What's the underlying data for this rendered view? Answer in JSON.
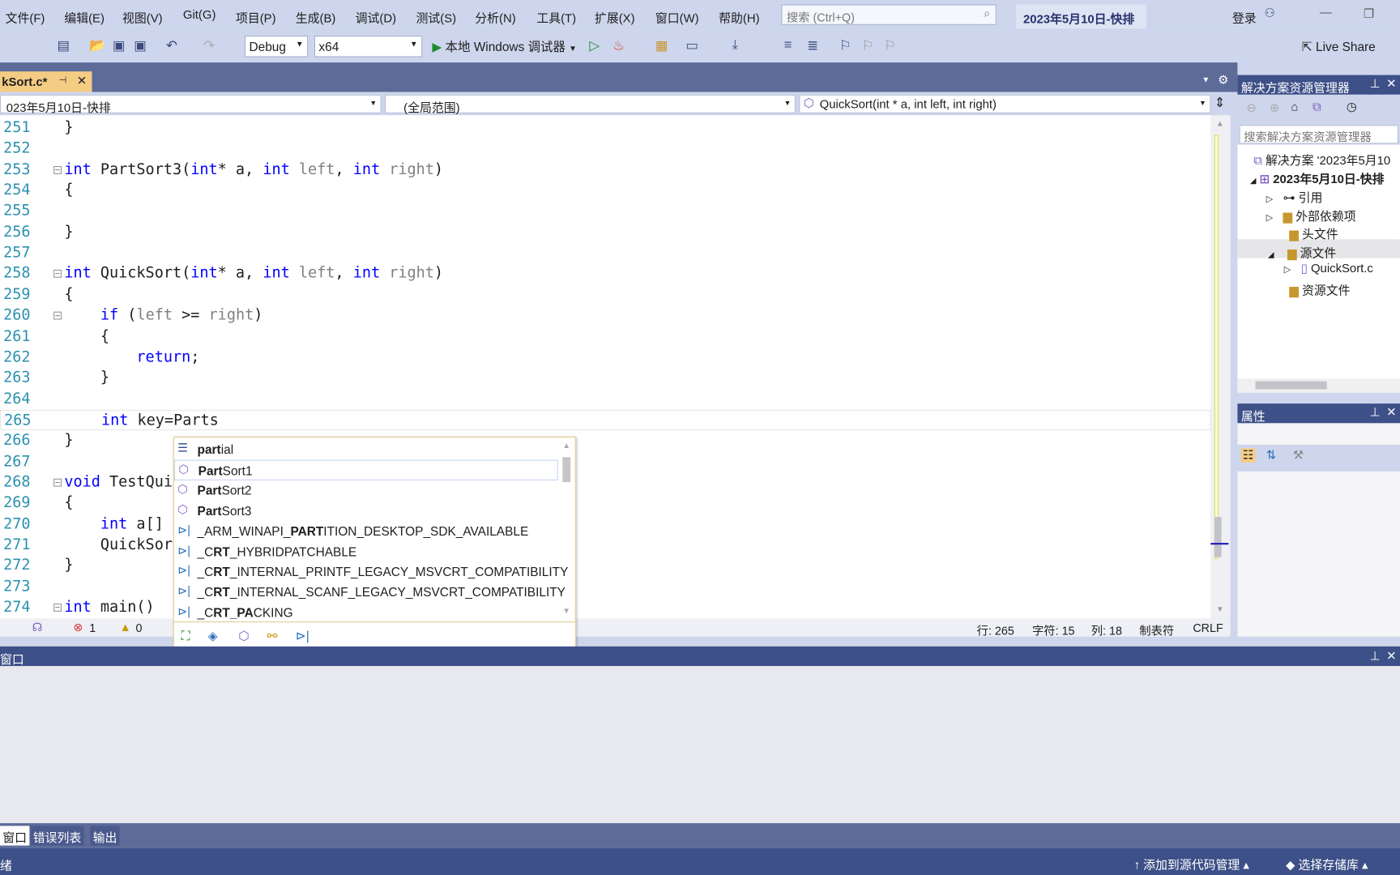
{
  "menu": [
    "文件(F)",
    "编辑(E)",
    "视图(V)",
    "Git(G)",
    "项目(P)",
    "生成(B)",
    "调试(D)",
    "测试(S)",
    "分析(N)",
    "工具(T)",
    "扩展(X)",
    "窗口(W)",
    "帮助(H)"
  ],
  "search": {
    "placeholder": "搜索 (Ctrl+Q)"
  },
  "window_title": "2023年5月10日-快排",
  "sign_in": "登录",
  "toolbar": {
    "config": "Debug",
    "platform": "x64",
    "run_label": "本地 Windows 调试器",
    "live_share": "Live Share"
  },
  "doc_tab": {
    "label": "kSort.c*"
  },
  "navbar": {
    "project": "023年5月10日-快排",
    "scope": "(全局范围)",
    "member": "QuickSort(int * a, int left, int right)"
  },
  "code": [
    {
      "n": "251",
      "t": "}"
    },
    {
      "n": "252",
      "t": ""
    },
    {
      "n": "253",
      "t": "int PartSort3(int* a, int left, int right)"
    },
    {
      "n": "254",
      "t": "{"
    },
    {
      "n": "255",
      "t": ""
    },
    {
      "n": "256",
      "t": "}"
    },
    {
      "n": "257",
      "t": ""
    },
    {
      "n": "258",
      "t": "int QuickSort(int* a, int left, int right)"
    },
    {
      "n": "259",
      "t": "{"
    },
    {
      "n": "260",
      "t": "    if (left >= right)"
    },
    {
      "n": "261",
      "t": "    {"
    },
    {
      "n": "262",
      "t": "        return;"
    },
    {
      "n": "263",
      "t": "    }"
    },
    {
      "n": "264",
      "t": ""
    },
    {
      "n": "265",
      "t": "    int key=Parts"
    },
    {
      "n": "266",
      "t": "}"
    },
    {
      "n": "267",
      "t": ""
    },
    {
      "n": "268",
      "t": "void TestQui"
    },
    {
      "n": "269",
      "t": "{"
    },
    {
      "n": "270",
      "t": "    int a[]"
    },
    {
      "n": "271",
      "t": "    QuickSor"
    },
    {
      "n": "272",
      "t": "}"
    },
    {
      "n": "273",
      "t": ""
    },
    {
      "n": "274",
      "t": "int main()"
    }
  ],
  "autocomplete": {
    "items": [
      {
        "icon": "keyword-icon",
        "bold": "part",
        "rest": "ial",
        "pre": ""
      },
      {
        "icon": "function-icon",
        "bold": "Part",
        "rest": "Sort1",
        "pre": "",
        "selected": true
      },
      {
        "icon": "function-icon",
        "bold": "Part",
        "rest": "Sort2",
        "pre": ""
      },
      {
        "icon": "function-icon",
        "bold": "Part",
        "rest": "Sort3",
        "pre": ""
      },
      {
        "icon": "macro-icon",
        "pre": "_ARM_WINAPI_",
        "bold": "PART",
        "rest": "ITION_DESKTOP_SDK_AVAILABLE"
      },
      {
        "icon": "macro-icon",
        "pre": "_C",
        "bold": "RT",
        "rest": "_HYBRIDPATCHABLE"
      },
      {
        "icon": "macro-icon",
        "pre": "_C",
        "bold": "RT",
        "rest": "_INTERNAL_PRINTF_LEGACY_MSVCRT_COMPATIBILITY"
      },
      {
        "icon": "macro-icon",
        "pre": "_C",
        "bold": "RT",
        "rest": "_INTERNAL_SCANF_LEGACY_MSVCRT_COMPATIBILITY"
      },
      {
        "icon": "macro-icon",
        "pre": "_C",
        "bold": "RT_PA",
        "rest": "CKING"
      }
    ]
  },
  "editor_status": {
    "errors": "1",
    "warnings": "0",
    "line": "行: 265",
    "char": "字符: 15",
    "col": "列: 18",
    "tabs": "制表符",
    "eol": "CRLF"
  },
  "solution_explorer": {
    "title": "解决方案资源管理器",
    "search_placeholder": "搜索解决方案资源管理器",
    "items": [
      {
        "label": "解决方案 '2023年5月10"
      },
      {
        "label": "2023年5月10日-快排"
      },
      {
        "label": "引用"
      },
      {
        "label": "外部依赖项"
      },
      {
        "label": "头文件"
      },
      {
        "label": "源文件"
      },
      {
        "label": "QuickSort.c"
      },
      {
        "label": "资源文件"
      }
    ]
  },
  "properties": {
    "title": "属性"
  },
  "bottom_panel": {
    "title": "窗口",
    "tabs": [
      "窗口",
      "错误列表",
      "输出"
    ]
  },
  "statusbar": {
    "ready": "绪",
    "add_source": "添加到源代码管理",
    "select_repo": "选择存储库"
  }
}
